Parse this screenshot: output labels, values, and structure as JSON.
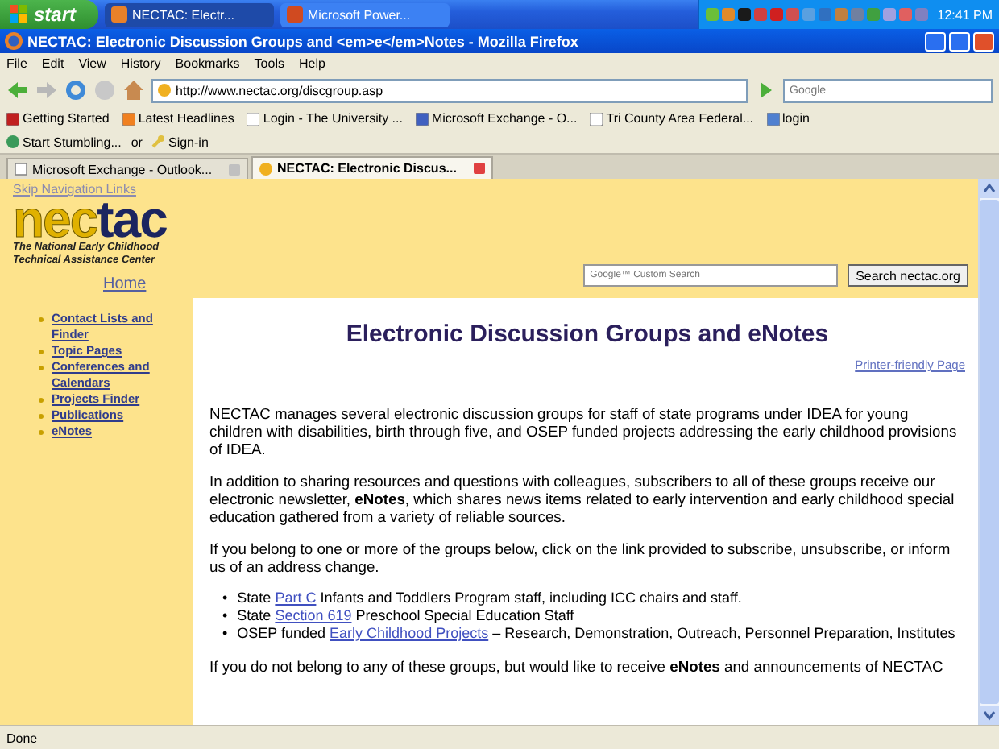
{
  "taskbar": {
    "start": "start",
    "buttons": [
      {
        "label": "NECTAC: Electr...",
        "selected": true
      },
      {
        "label": "Microsoft Power...",
        "selected": false
      }
    ],
    "clock": "12:41 PM"
  },
  "window": {
    "title": "NECTAC: Electronic Discussion Groups and <em>e</em>Notes - Mozilla Firefox"
  },
  "menu": [
    "File",
    "Edit",
    "View",
    "History",
    "Bookmarks",
    "Tools",
    "Help"
  ],
  "nav": {
    "url": "http://www.nectac.org/discgroup.asp",
    "search_placeholder": "Google"
  },
  "bookmarks": [
    "Getting Started",
    "Latest Headlines",
    "Login - The University ...",
    "Microsoft Exchange - O...",
    "Tri County Area Federal...",
    "login"
  ],
  "stumble": {
    "start": "Start Stumbling...",
    "or": "or",
    "signin": "Sign-in"
  },
  "tabs": [
    {
      "label": "Microsoft Exchange - Outlook...",
      "selected": false
    },
    {
      "label": "NECTAC: Electronic Discus...",
      "selected": true
    }
  ],
  "page": {
    "skip_link": "Skip Navigation Links",
    "logo": {
      "left": "nec",
      "right": "tac",
      "tagline": [
        "The National Early Childhood",
        "Technical Assistance Center"
      ]
    },
    "home": "Home",
    "search_placeholder": "Google™ Custom Search",
    "search_button": "Search nectac.org",
    "sidebar": [
      {
        "label": "Contact Lists and Finder"
      },
      {
        "label": "Topic Pages"
      },
      {
        "label": "Conferences and Calendars"
      },
      {
        "label": "Projects Finder"
      },
      {
        "label": "Publications"
      },
      {
        "label": "eNotes"
      }
    ],
    "heading": "Electronic Discussion Groups and eNotes",
    "printer_link": "Printer-friendly Page",
    "paragraphs": [
      "NECTAC manages several electronic discussion groups for staff of state programs under IDEA for young children with disabilities, birth through five, and OSEP funded projects addressing the early childhood provisions of IDEA.",
      "In addition to sharing resources and questions with colleagues, subscribers to all of these groups receive our electronic newsletter, **eNotes**, which shares news items related to early intervention and early childhood special education gathered from a variety of reliable sources.",
      "If you belong to one or more of the groups below, click on the link provided to subscribe, unsubscribe, or inform us of an address change."
    ],
    "bullets": [
      {
        "marker": "•",
        "before": "State",
        "link": "Part C",
        "after": "Infants and Toddlers Program staff, including ICC chairs and staff."
      },
      {
        "marker": "•",
        "before": "State",
        "link": "Section 619",
        "after": "Preschool Special Education Staff"
      },
      {
        "marker": "•",
        "before": "OSEP funded",
        "link": "Early Childhood Projects",
        "after": "– Research, Demonstration, Outreach, Personnel Preparation, Institutes"
      }
    ],
    "last_paragraph": "If you do not belong to any of these groups, but would like to receive **eNotes** and announcements of NECTAC"
  },
  "status": "Done"
}
